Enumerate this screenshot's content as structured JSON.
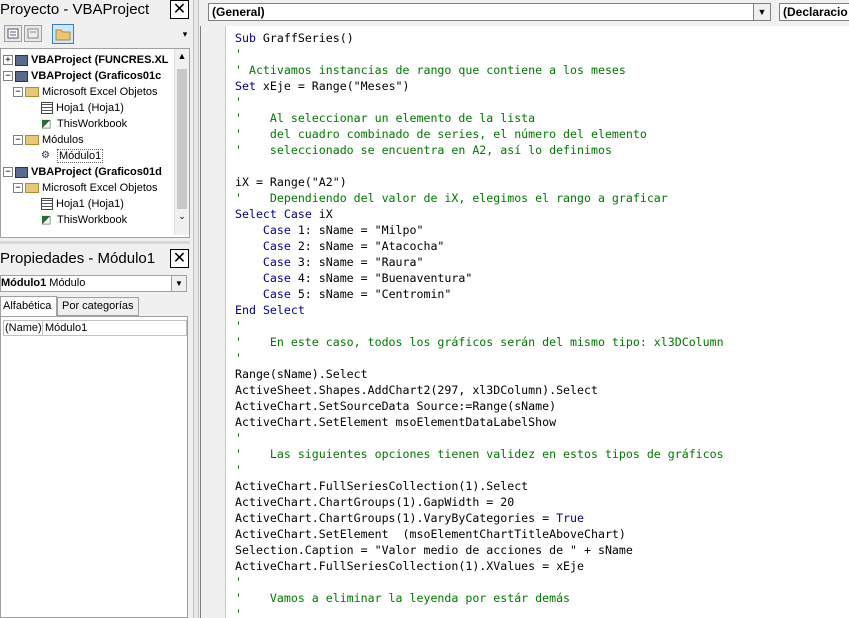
{
  "project_panel": {
    "title": "Proyecto - VBAProject",
    "close": "✕",
    "tree": [
      {
        "label": "VBAProject (FUNCRES.XL",
        "bold": true,
        "level": 0,
        "expander": "+",
        "icon": "project"
      },
      {
        "label": "VBAProject (Graficos01c",
        "bold": true,
        "level": 0,
        "expander": "−",
        "icon": "project"
      },
      {
        "label": "Microsoft Excel Objetos",
        "bold": false,
        "level": 1,
        "expander": "−",
        "icon": "folder"
      },
      {
        "label": "Hoja1 (Hoja1)",
        "bold": false,
        "level": 2,
        "expander": "",
        "icon": "sheet"
      },
      {
        "label": "ThisWorkbook",
        "bold": false,
        "level": 2,
        "expander": "",
        "icon": "workbook"
      },
      {
        "label": "Módulos",
        "bold": false,
        "level": 1,
        "expander": "−",
        "icon": "folder"
      },
      {
        "label": "Módulo1",
        "bold": false,
        "level": 2,
        "expander": "",
        "icon": "module",
        "selected": true
      },
      {
        "label": "VBAProject (Graficos01d",
        "bold": true,
        "level": 0,
        "expander": "−",
        "icon": "project"
      },
      {
        "label": "Microsoft Excel Objetos",
        "bold": false,
        "level": 1,
        "expander": "−",
        "icon": "folder"
      },
      {
        "label": "Hoja1 (Hoja1)",
        "bold": false,
        "level": 2,
        "expander": "",
        "icon": "sheet"
      },
      {
        "label": "ThisWorkbook",
        "bold": false,
        "level": 2,
        "expander": "",
        "icon": "workbook"
      }
    ]
  },
  "properties_panel": {
    "title": "Propiedades - Módulo1",
    "close": "✕",
    "object_name": "Módulo1",
    "object_type": "Módulo",
    "tab_alpha": "Alfabética",
    "tab_category": "Por categorías",
    "prop_name": "(Name)",
    "prop_value": "Módulo1"
  },
  "code_window": {
    "object_combo": "(General)",
    "proc_combo": "(Declaracio",
    "lines": [
      {
        "t": "kw",
        "s": "Sub GraffSeries()"
      },
      {
        "t": "cm",
        "s": "'"
      },
      {
        "t": "cm",
        "s": "' Activamos instancias de rango que contiene a los meses"
      },
      {
        "t": "kw",
        "s": "Set xEje = Range(\"Meses\")"
      },
      {
        "t": "cm",
        "s": "'"
      },
      {
        "t": "cm",
        "s": "'    Al seleccionar un elemento de la lista"
      },
      {
        "t": "cm",
        "s": "'    del cuadro combinado de series, el número del elemento"
      },
      {
        "t": "cm",
        "s": "'    seleccionado se encuentra en A2, así lo definimos"
      },
      {
        "t": "tx",
        "s": ""
      },
      {
        "t": "tx",
        "s": "iX = Range(\"A2\")"
      },
      {
        "t": "cm",
        "s": "'    Dependiendo del valor de iX, elegimos el rango a graficar"
      },
      {
        "t": "kw",
        "s": "Select Case iX"
      },
      {
        "t": "kw",
        "s": "    Case 1: sName = \"Milpo\""
      },
      {
        "t": "kw",
        "s": "    Case 2: sName = \"Atacocha\""
      },
      {
        "t": "kw",
        "s": "    Case 3: sName = \"Raura\""
      },
      {
        "t": "kw",
        "s": "    Case 4: sName = \"Buenaventura\""
      },
      {
        "t": "kw",
        "s": "    Case 5: sName = \"Centromin\""
      },
      {
        "t": "kw",
        "s": "End Select"
      },
      {
        "t": "cm",
        "s": "'"
      },
      {
        "t": "cm",
        "s": "'    En este caso, todos los gráficos serán del mismo tipo: xl3DColumn"
      },
      {
        "t": "cm",
        "s": "'"
      },
      {
        "t": "tx",
        "s": "Range(sName).Select"
      },
      {
        "t": "tx",
        "s": "ActiveSheet.Shapes.AddChart2(297, xl3DColumn).Select"
      },
      {
        "t": "tx",
        "s": "ActiveChart.SetSourceData Source:=Range(sName)"
      },
      {
        "t": "tx",
        "s": "ActiveChart.SetElement msoElementDataLabelShow"
      },
      {
        "t": "cm",
        "s": "'"
      },
      {
        "t": "cm",
        "s": "'    Las siguientes opciones tienen validez en estos tipos de gráficos"
      },
      {
        "t": "cm",
        "s": "'"
      },
      {
        "t": "tx",
        "s": "ActiveChart.FullSeriesCollection(1).Select"
      },
      {
        "t": "tx",
        "s": "ActiveChart.ChartGroups(1).GapWidth = 20"
      },
      {
        "t": "kw2",
        "s": "ActiveChart.ChartGroups(1).VaryByCategories = True"
      },
      {
        "t": "tx",
        "s": "ActiveChart.SetElement  (msoElementChartTitleAboveChart)"
      },
      {
        "t": "tx",
        "s": "Selection.Caption = \"Valor medio de acciones de \" + sName"
      },
      {
        "t": "tx",
        "s": "ActiveChart.FullSeriesCollection(1).XValues = xEje"
      },
      {
        "t": "cm",
        "s": "'"
      },
      {
        "t": "cm",
        "s": "'    Vamos a eliminar la leyenda por estár demás"
      },
      {
        "t": "cm",
        "s": "'"
      }
    ]
  },
  "colors": {
    "keyword": "#00008b",
    "comment": "#007800",
    "selection": "#cce8ff"
  }
}
